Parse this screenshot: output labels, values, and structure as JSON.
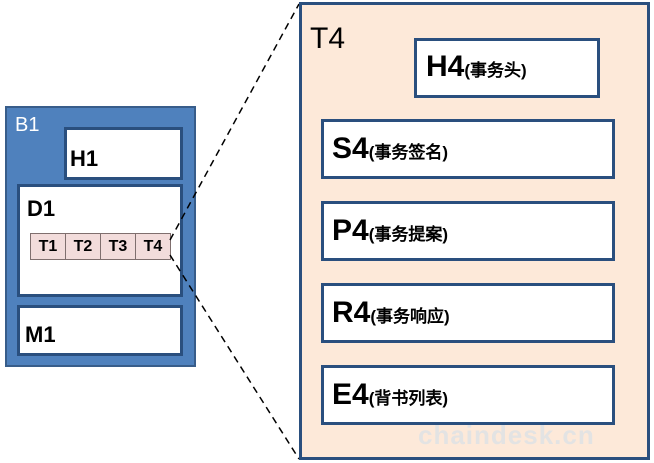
{
  "left": {
    "outer_label": "B1",
    "header_label": "H1",
    "data_label": "D1",
    "m_label": "M1",
    "cells": [
      "T1",
      "T2",
      "T3",
      "T4"
    ]
  },
  "right": {
    "title": "T4",
    "items": [
      {
        "code": "H4",
        "desc": "(事务头)"
      },
      {
        "code": "S4",
        "desc": "(事务签名)"
      },
      {
        "code": "P4",
        "desc": "(事务提案)"
      },
      {
        "code": "R4",
        "desc": "(事务响应)"
      },
      {
        "code": "E4",
        "desc": "(背书列表)"
      }
    ]
  },
  "watermark": "chaindesk.cn",
  "colors": {
    "outer_block": "#4f81bd",
    "border": "#2a4f7e",
    "cell_fill": "#f2dcdb",
    "detail_fill": "#fde9d9"
  }
}
